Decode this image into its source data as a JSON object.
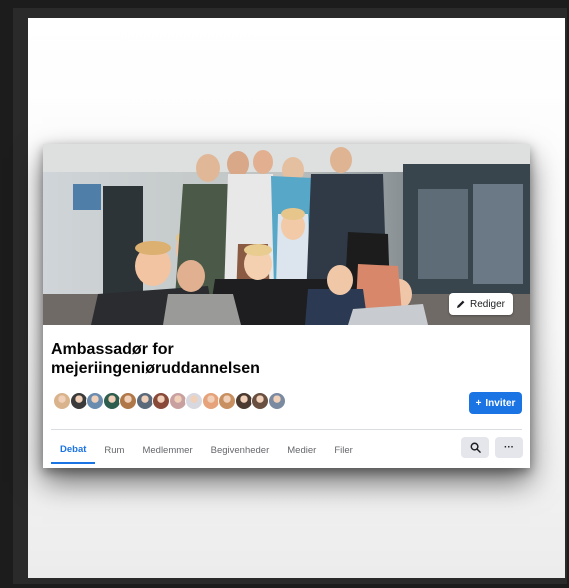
{
  "group": {
    "title": "Ambassadør for mejeriingeniøruddannelsen",
    "edit_label": "Rediger",
    "invite_label": "Inviter",
    "invite_icon": "+",
    "more_label": "···"
  },
  "tabs": [
    {
      "label": "Debat",
      "active": true
    },
    {
      "label": "Rum",
      "active": false
    },
    {
      "label": "Medlemmer",
      "active": false
    },
    {
      "label": "Begivenheder",
      "active": false
    },
    {
      "label": "Medier",
      "active": false
    },
    {
      "label": "Filer",
      "active": false
    }
  ],
  "member_avatar_colors": [
    "#d9b38c",
    "#3b3b3b",
    "#6a8caf",
    "#2e5e4e",
    "#b07848",
    "#5a6a7a",
    "#8a4a3a",
    "#c9a0a0",
    "#d8d8e0",
    "#e6a27a",
    "#c89060",
    "#4a3a30",
    "#6a5040",
    "#7a8aa0"
  ],
  "colors": {
    "accent": "#1b74e4",
    "tab_inactive": "#65676b",
    "title": "#050505"
  },
  "icons": {
    "edit": "pencil-icon",
    "search": "search-icon",
    "more": "more-icon",
    "invite": "plus-icon"
  }
}
